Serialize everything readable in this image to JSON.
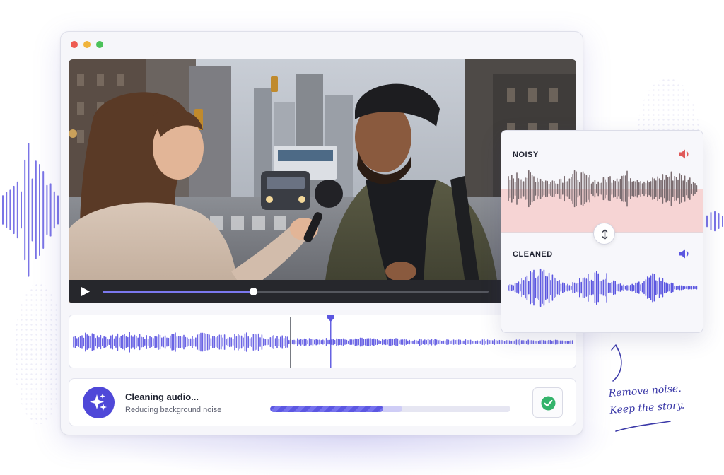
{
  "window": {
    "controls": [
      "close",
      "minimize",
      "maximize"
    ]
  },
  "player": {
    "play_icon": "play-icon",
    "progress_percent": 39
  },
  "timeline": {
    "playhead_percent": 51.5
  },
  "status": {
    "title": "Cleaning audio...",
    "subtitle": "Reducing background noise",
    "progress_percent": 47,
    "buffer_percent": 55,
    "badge_icon": "sparkle-icon",
    "done_icon": "check-circle-icon"
  },
  "compare": {
    "noisy_label": "NOISY",
    "cleaned_label": "CLEANED",
    "noisy_icon": "speaker-icon",
    "cleaned_icon": "speaker-icon",
    "swap_icon": "swap-vertical-icon"
  },
  "tagline": {
    "line1": "Remove noise.",
    "line2": "Keep the story."
  },
  "colors": {
    "accent": "#5b56e0",
    "noisy": "#e05a5a",
    "success": "#34b36b"
  }
}
